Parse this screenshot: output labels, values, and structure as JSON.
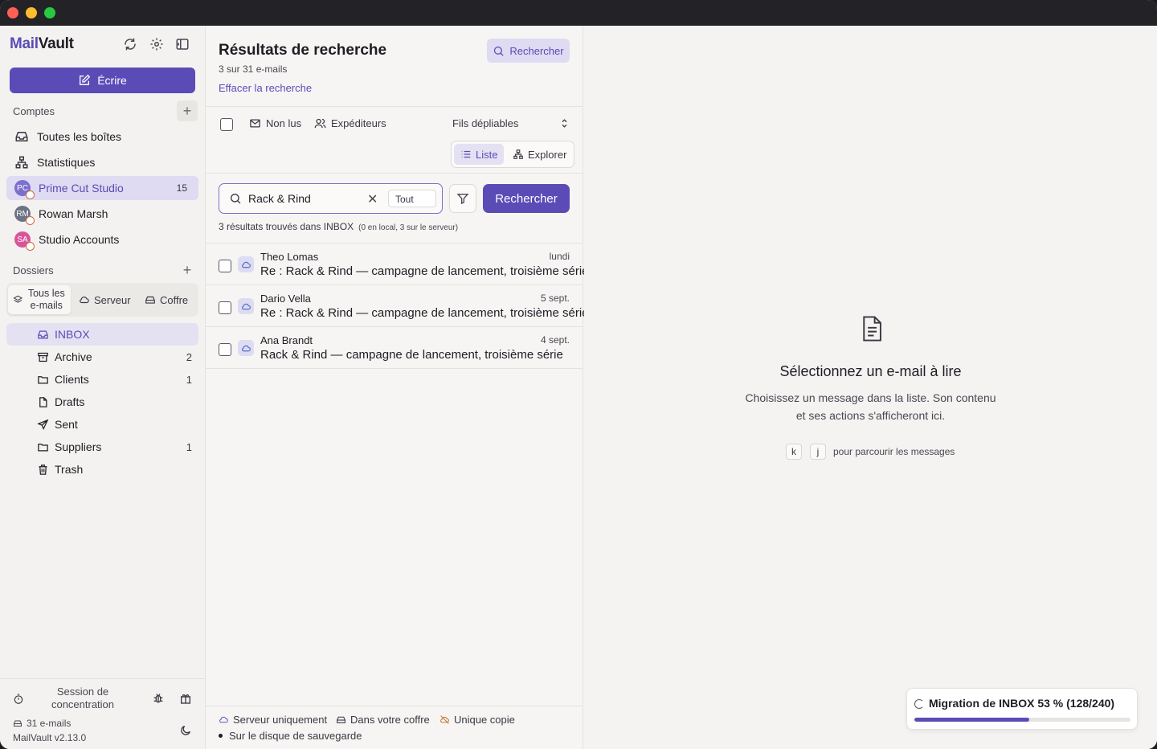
{
  "app": {
    "brand_left": "Mail",
    "brand_right": "Vault"
  },
  "sidebar": {
    "compose_label": "Écrire",
    "accounts_label": "Comptes",
    "nav": [
      {
        "label": "Toutes les boîtes",
        "icon": "inbox-icon"
      },
      {
        "label": "Statistiques",
        "icon": "network-icon"
      }
    ],
    "accounts": [
      {
        "label": "Prime Cut Studio",
        "initials": "PC",
        "count": "15",
        "color": "#7b6fd0"
      },
      {
        "label": "Rowan Marsh",
        "initials": "RM",
        "color": "#6b7385"
      },
      {
        "label": "Studio Accounts",
        "initials": "SA",
        "color": "#d9559b"
      }
    ],
    "folders_label": "Dossiers",
    "scope_tabs": {
      "all": "Tous les e-mails",
      "server": "Serveur",
      "vault": "Coffre"
    },
    "folders": [
      {
        "label": "INBOX",
        "icon": "inbox-icon",
        "count": ""
      },
      {
        "label": "Archive",
        "icon": "archive-icon",
        "count": "2"
      },
      {
        "label": "Clients",
        "icon": "folder-icon",
        "count": "1"
      },
      {
        "label": "Drafts",
        "icon": "file-icon",
        "count": ""
      },
      {
        "label": "Sent",
        "icon": "send-icon",
        "count": ""
      },
      {
        "label": "Suppliers",
        "icon": "folder-icon",
        "count": "1"
      },
      {
        "label": "Trash",
        "icon": "trash-icon",
        "count": ""
      }
    ],
    "footer": {
      "focus_session": "Session de concentration",
      "email_count": "31 e-mails",
      "version": "MailVault v2.13.0"
    }
  },
  "list": {
    "title": "Résultats de recherche",
    "subtitle": "3 sur 31 e-mails",
    "clear_link": "Effacer la recherche",
    "search_top_label": "Rechercher",
    "filters": {
      "unread": "Non lus",
      "senders": "Expéditeurs",
      "threads": "Fils dépliables"
    },
    "view": {
      "list": "Liste",
      "explore": "Explorer"
    },
    "search": {
      "query": "Rack & Rind",
      "scope": "Tout",
      "button": "Rechercher"
    },
    "results": {
      "count": "3",
      "text": "résultats trouvés dans INBOX",
      "detail": "(0 en local, 3 sur le serveur)"
    },
    "messages": [
      {
        "sender": "Theo Lomas",
        "date": "lundi",
        "subject": "Re : Rack & Rind — campagne de lancement, troisième série"
      },
      {
        "sender": "Dario Vella",
        "date": "5 sept.",
        "subject": "Re : Rack & Rind — campagne de lancement, troisième série"
      },
      {
        "sender": "Ana Brandt",
        "date": "4 sept.",
        "subject": "Rack & Rind — campagne de lancement, troisième série"
      }
    ],
    "legend": {
      "server_only": "Serveur uniquement",
      "in_vault": "Dans votre coffre",
      "single_copy": "Unique copie",
      "backup_disk": "Sur le disque de sauvegarde"
    }
  },
  "reading": {
    "title": "Sélectionnez un e-mail à lire",
    "desc_line1": "Choisissez un message dans la liste. Son contenu",
    "desc_line2": "et ses actions s'afficheront ici.",
    "key_k": "k",
    "key_j": "j",
    "keys_hint": "pour parcourir les messages"
  },
  "migration": {
    "label": "Migration de INBOX 53 % (128/240)",
    "progress_fraction": 0.53
  },
  "colors": {
    "accent": "#5b4bb7",
    "accent_soft": "#dedbf2"
  }
}
